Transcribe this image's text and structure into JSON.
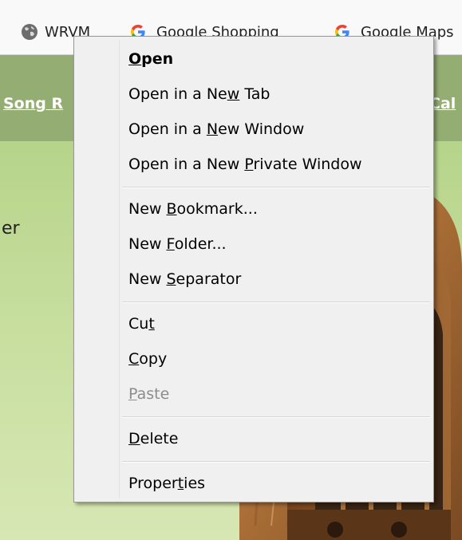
{
  "bookmarks_bar": {
    "items": [
      {
        "label": "WRVM",
        "icon": "globe-icon"
      },
      {
        "label": "Google Shopping",
        "icon": "google-icon"
      },
      {
        "label": "Google Maps",
        "icon": "google-icon"
      }
    ]
  },
  "page": {
    "nav_left": "Song R",
    "nav_right": "Cal",
    "body_text": "er",
    "colors": {
      "nav_band": "#94ad72",
      "content_bg": "#c7de9e"
    }
  },
  "context_menu": {
    "items": [
      {
        "before": "",
        "key": "O",
        "after": "pen"
      },
      {
        "before": "Open in a Ne",
        "key": "w",
        "after": " Tab"
      },
      {
        "before": "Open in a ",
        "key": "N",
        "after": "ew Window"
      },
      {
        "before": "Open in a New ",
        "key": "P",
        "after": "rivate Window"
      },
      {
        "before": "New ",
        "key": "B",
        "after": "ookmark..."
      },
      {
        "before": "New ",
        "key": "F",
        "after": "older..."
      },
      {
        "before": "New ",
        "key": "S",
        "after": "eparator"
      },
      {
        "before": "Cu",
        "key": "t",
        "after": ""
      },
      {
        "before": "",
        "key": "C",
        "after": "opy"
      },
      {
        "before": "",
        "key": "P",
        "after": "aste"
      },
      {
        "before": "",
        "key": "D",
        "after": "elete"
      },
      {
        "before": "Proper",
        "key": "t",
        "after": "ies"
      }
    ],
    "disabled_color": "#8c8c8c"
  }
}
